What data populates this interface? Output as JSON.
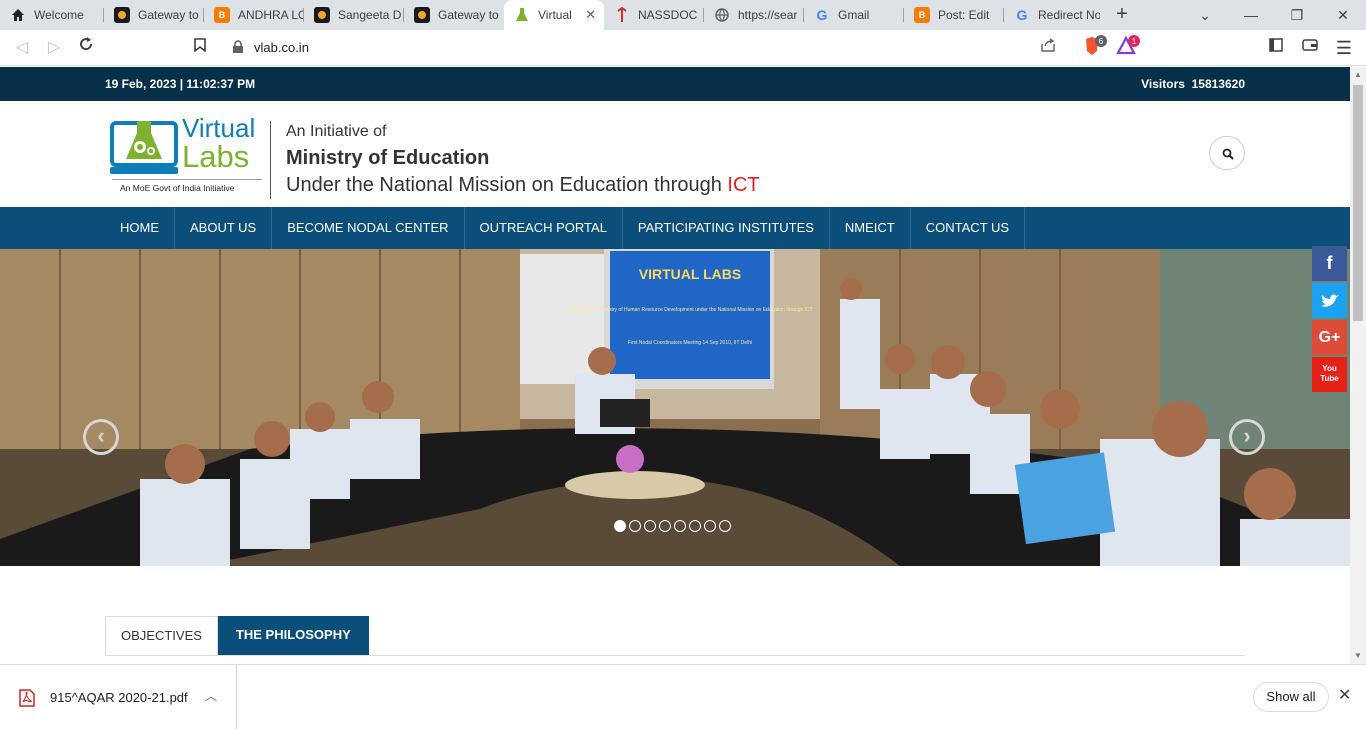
{
  "browser": {
    "tabs": [
      {
        "title": "Welcome",
        "favicon": "home-icon"
      },
      {
        "title": "Gateway to",
        "favicon": "gateway-icon"
      },
      {
        "title": "ANDHRA LO",
        "favicon": "blogger-icon"
      },
      {
        "title": "Sangeeta D",
        "favicon": "gateway-icon"
      },
      {
        "title": "Gateway to",
        "favicon": "gateway-icon"
      },
      {
        "title": "Virtual",
        "favicon": "vlab-icon",
        "active": true
      },
      {
        "title": "NASSDOC",
        "favicon": "nassdoc-icon"
      },
      {
        "title": "https://sear",
        "favicon": "globe-icon"
      },
      {
        "title": "Gmail",
        "favicon": "google-icon"
      },
      {
        "title": "Post: Edit",
        "favicon": "blogger-icon"
      },
      {
        "title": "Redirect No",
        "favicon": "google-icon"
      }
    ],
    "new_tab": "+",
    "url": "vlab.co.in",
    "brave_shield_count": "6",
    "rewards_count": "1"
  },
  "site": {
    "datetime": "19 Feb, 2023 | 11:02:37 PM",
    "visitors_label": "Visitors",
    "visitors_count": "15813620",
    "logo": {
      "line1": "Virtual",
      "line2": "Labs",
      "tagline": "An MoE Govt of India Initiative"
    },
    "header": {
      "initiative": "An Initiative of",
      "ministry": "Ministry of Education",
      "mission": "Under the National Mission on Education through",
      "mission_highlight": "ICT"
    },
    "nav": [
      "HOME",
      "ABOUT US",
      "BECOME NODAL CENTER",
      "OUTREACH PORTAL",
      "PARTICIPATING INSTITUTES",
      "NMEICT",
      "CONTACT US"
    ],
    "slider": {
      "screen_title": "VIRTUAL LABS",
      "screen_text": "An initiative of Ministry of Human Resource Development under the National Mission on Education through ICT",
      "screen_footer": "First Nodal Coordinators Meeting 14 Sep 2010, IIT Delhi",
      "slide_count": 8,
      "active_slide": 1
    },
    "social": [
      "f",
      "t",
      "G+",
      "You Tube"
    ],
    "content_tabs": [
      "OBJECTIVES",
      "THE PHILOSOPHY"
    ]
  },
  "downloads": {
    "file_name": "915^AQAR 2020-21.pdf",
    "show_all": "Show all"
  },
  "colors": {
    "navy": "#062f49",
    "nav_blue": "#0b4e7a",
    "ict_red": "#e21e26",
    "logo_blue": "#0e7fb6",
    "logo_green": "#7cb22f"
  }
}
